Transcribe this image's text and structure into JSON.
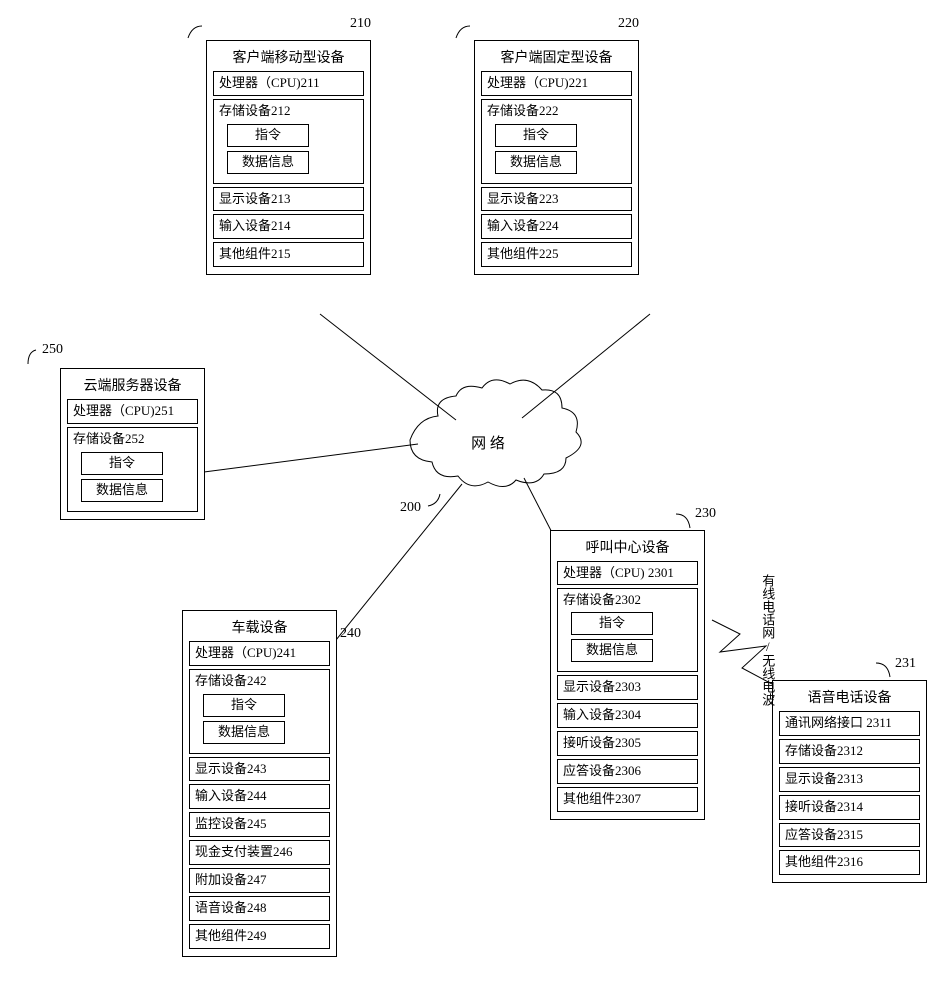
{
  "network": {
    "label": "网 络",
    "ref": "200"
  },
  "devices": {
    "mobile": {
      "ref": "210",
      "title": "客户端移动型设备",
      "cpu": "处理器（CPU)211",
      "storage": {
        "label": "存储设备212",
        "cmd": "指令",
        "data": "数据信息"
      },
      "display": "显示设备213",
      "input": "输入设备214",
      "other": "其他组件215"
    },
    "fixed": {
      "ref": "220",
      "title": "客户端固定型设备",
      "cpu": "处理器（CPU)221",
      "storage": {
        "label": "存储设备222",
        "cmd": "指令",
        "data": "数据信息"
      },
      "display": "显示设备223",
      "input": "输入设备224",
      "other": "其他组件225"
    },
    "cloud": {
      "ref": "250",
      "title": "云端服务器设备",
      "cpu": "处理器（CPU)251",
      "storage": {
        "label": "存储设备252",
        "cmd": "指令",
        "data": "数据信息"
      }
    },
    "vehicle": {
      "ref": "240",
      "title": "车载设备",
      "cpu": "处理器（CPU)241",
      "storage": {
        "label": "存储设备242",
        "cmd": "指令",
        "data": "数据信息"
      },
      "display": "显示设备243",
      "input": "输入设备244",
      "monitor": "监控设备245",
      "cash": "现金支付装置246",
      "addon": "附加设备247",
      "voice": "语音设备248",
      "other": "其他组件249"
    },
    "callcenter": {
      "ref": "230",
      "title": "呼叫中心设备",
      "cpu": "处理器（CPU) 2301",
      "storage": {
        "label": "存储设备2302",
        "cmd": "指令",
        "data": "数据信息"
      },
      "display": "显示设备2303",
      "input": "输入设备2304",
      "answer": "接听设备2305",
      "respond": "应答设备2306",
      "other": "其他组件2307"
    },
    "phone": {
      "ref": "231",
      "title": "语音电话设备",
      "net": "通讯网络接口 2311",
      "storage": "存储设备2312",
      "display": "显示设备2313",
      "answer": "接听设备2314",
      "respond": "应答设备2315",
      "other": "其他组件2316"
    }
  },
  "connection_label": "有线电话网/无线电波"
}
